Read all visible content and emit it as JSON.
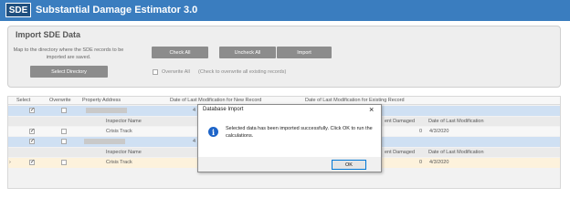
{
  "app": {
    "logo_text": "SDE",
    "title": "Substantial Damage Estimator 3.0"
  },
  "import_panel": {
    "title": "Import SDE Data",
    "description": "Map to the directory where the SDE records to be imported are saved.",
    "select_directory_label": "Select Directory",
    "check_all_label": "Check All",
    "uncheck_all_label": "Uncheck All",
    "import_label": "Import",
    "overwrite_all_label": "Overwrite All",
    "overwrite_hint": "(Check to overwrite all existing records)"
  },
  "grid": {
    "headers": {
      "select": "Select",
      "overwrite": "Overwrite",
      "property_address": "Property Address",
      "date_new": "Date of Last Modification for New Record",
      "date_existing": "Date of Last Modification for Existing Record"
    },
    "row1_partial": "4",
    "sub_headers": {
      "inspector_name": "Inspector Name",
      "percent_damaged": "ent Damaged",
      "date_last_mod": "Date of Last Modification"
    },
    "row1_detail": {
      "inspector": "Crisis Track",
      "damaged": "0",
      "date": "4/3/2020"
    },
    "row2_partial": "4",
    "row2_detail": {
      "inspector": "Crisis Track",
      "damaged": "0",
      "date": "4/3/2020"
    },
    "row_indicator": "›"
  },
  "dialog": {
    "title": "Database Import",
    "close_glyph": "×",
    "message": "Selected data has been imported successfully. Click OK to run the calculations.",
    "ok_label": "OK",
    "icon_glyph": "i"
  },
  "colors": {
    "titlebar": "#3a7dbf",
    "button": "#8c8c8c",
    "selected_row": "#cfe0f3",
    "highlight_row": "#fdf2dc",
    "info_icon": "#1d64c8"
  }
}
